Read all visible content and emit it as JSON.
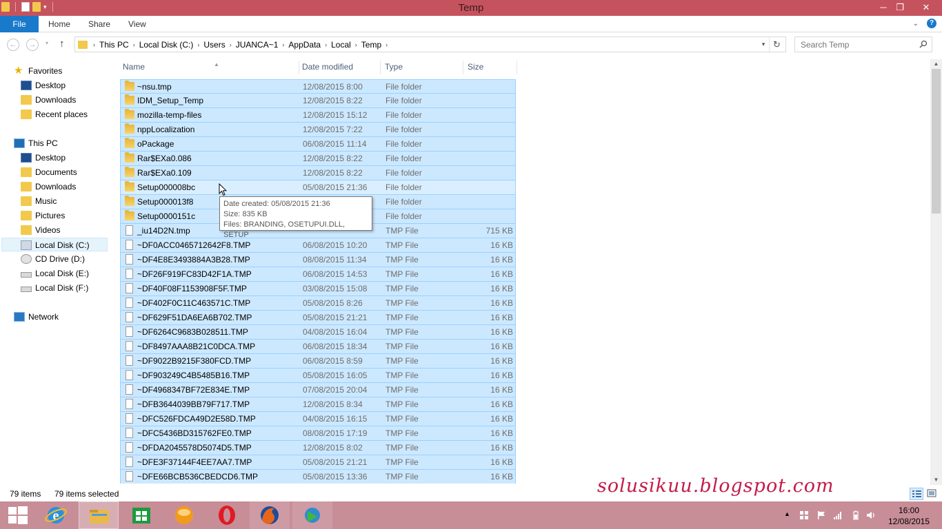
{
  "window": {
    "title": "Temp"
  },
  "ribbon": {
    "tabs": [
      "File",
      "Home",
      "Share",
      "View"
    ]
  },
  "breadcrumb": [
    "This PC",
    "Local Disk (C:)",
    "Users",
    "JUANCA~1",
    "AppData",
    "Local",
    "Temp"
  ],
  "search": {
    "placeholder": "Search Temp"
  },
  "nav": {
    "favorites_label": "Favorites",
    "favorites": [
      "Desktop",
      "Downloads",
      "Recent places"
    ],
    "thispc_label": "This PC",
    "thispc": [
      "Desktop",
      "Documents",
      "Downloads",
      "Music",
      "Pictures",
      "Videos",
      "Local Disk (C:)",
      "CD Drive (D:)",
      "Local Disk (E:)",
      "Local Disk (F:)"
    ],
    "network_label": "Network",
    "selected": "Local Disk (C:)"
  },
  "columns": [
    "Name",
    "Date modified",
    "Type",
    "Size"
  ],
  "files": [
    {
      "name": "~nsu.tmp",
      "date": "12/08/2015 8:00",
      "type": "File folder",
      "size": "",
      "kind": "folder"
    },
    {
      "name": "IDM_Setup_Temp",
      "date": "12/08/2015 8:22",
      "type": "File folder",
      "size": "",
      "kind": "folder"
    },
    {
      "name": "mozilla-temp-files",
      "date": "12/08/2015 15:12",
      "type": "File folder",
      "size": "",
      "kind": "folder"
    },
    {
      "name": "nppLocalization",
      "date": "12/08/2015 7:22",
      "type": "File folder",
      "size": "",
      "kind": "folder"
    },
    {
      "name": "oPackage",
      "date": "06/08/2015 11:14",
      "type": "File folder",
      "size": "",
      "kind": "folder"
    },
    {
      "name": "Rar$EXa0.086",
      "date": "12/08/2015 8:22",
      "type": "File folder",
      "size": "",
      "kind": "folder"
    },
    {
      "name": "Rar$EXa0.109",
      "date": "12/08/2015 8:22",
      "type": "File folder",
      "size": "",
      "kind": "folder"
    },
    {
      "name": "Setup000008bc",
      "date": "05/08/2015 21:36",
      "type": "File folder",
      "size": "",
      "kind": "folder"
    },
    {
      "name": "Setup000013f8",
      "date": "",
      "type": "File folder",
      "size": "",
      "kind": "folder"
    },
    {
      "name": "Setup0000151c",
      "date": "",
      "type": "File folder",
      "size": "",
      "kind": "folder"
    },
    {
      "name": "_iu14D2N.tmp",
      "date": "",
      "type": "TMP File",
      "size": "715 KB",
      "kind": "file"
    },
    {
      "name": "~DF0ACC0465712642F8.TMP",
      "date": "06/08/2015 10:20",
      "type": "TMP File",
      "size": "16 KB",
      "kind": "file"
    },
    {
      "name": "~DF4E8E3493884A3B28.TMP",
      "date": "08/08/2015 11:34",
      "type": "TMP File",
      "size": "16 KB",
      "kind": "file"
    },
    {
      "name": "~DF26F919FC83D42F1A.TMP",
      "date": "06/08/2015 14:53",
      "type": "TMP File",
      "size": "16 KB",
      "kind": "file"
    },
    {
      "name": "~DF40F08F1153908F5F.TMP",
      "date": "03/08/2015 15:08",
      "type": "TMP File",
      "size": "16 KB",
      "kind": "file"
    },
    {
      "name": "~DF402F0C11C463571C.TMP",
      "date": "05/08/2015 8:26",
      "type": "TMP File",
      "size": "16 KB",
      "kind": "file"
    },
    {
      "name": "~DF629F51DA6EA6B702.TMP",
      "date": "05/08/2015 21:21",
      "type": "TMP File",
      "size": "16 KB",
      "kind": "file"
    },
    {
      "name": "~DF6264C9683B028511.TMP",
      "date": "04/08/2015 16:04",
      "type": "TMP File",
      "size": "16 KB",
      "kind": "file"
    },
    {
      "name": "~DF8497AAA8B21C0DCA.TMP",
      "date": "06/08/2015 18:34",
      "type": "TMP File",
      "size": "16 KB",
      "kind": "file"
    },
    {
      "name": "~DF9022B9215F380FCD.TMP",
      "date": "06/08/2015 8:59",
      "type": "TMP File",
      "size": "16 KB",
      "kind": "file"
    },
    {
      "name": "~DF903249C4B5485B16.TMP",
      "date": "05/08/2015 16:05",
      "type": "TMP File",
      "size": "16 KB",
      "kind": "file"
    },
    {
      "name": "~DF4968347BF72E834E.TMP",
      "date": "07/08/2015 20:04",
      "type": "TMP File",
      "size": "16 KB",
      "kind": "file"
    },
    {
      "name": "~DFB3644039BB79F717.TMP",
      "date": "12/08/2015 8:34",
      "type": "TMP File",
      "size": "16 KB",
      "kind": "file"
    },
    {
      "name": "~DFC526FDCA49D2E58D.TMP",
      "date": "04/08/2015 16:15",
      "type": "TMP File",
      "size": "16 KB",
      "kind": "file"
    },
    {
      "name": "~DFC5436BD315762FE0.TMP",
      "date": "08/08/2015 17:19",
      "type": "TMP File",
      "size": "16 KB",
      "kind": "file"
    },
    {
      "name": "~DFDA2045578D5074D5.TMP",
      "date": "12/08/2015 8:02",
      "type": "TMP File",
      "size": "16 KB",
      "kind": "file"
    },
    {
      "name": "~DFE3F37144F4EE7AA7.TMP",
      "date": "05/08/2015 21:21",
      "type": "TMP File",
      "size": "16 KB",
      "kind": "file"
    },
    {
      "name": "~DFE66BCB536CBEDCD6.TMP",
      "date": "05/08/2015 13:36",
      "type": "TMP File",
      "size": "16 KB",
      "kind": "file"
    }
  ],
  "tooltip": {
    "line1": "Date created: 05/08/2015 21:36",
    "line2": "Size: 835 KB",
    "line3": "Files: BRANDING, OSETUPUI.DLL, SETUP"
  },
  "status": {
    "items": "79 items",
    "selected": "79 items selected"
  },
  "watermark": "solusikuu.blogspot.com",
  "clock": {
    "time": "16:00",
    "date": "12/08/2015"
  },
  "colors": {
    "titlebar": "#c5535e",
    "taskbar": "#c88e98",
    "selection": "#cce8ff",
    "accent": "#1979ca"
  }
}
